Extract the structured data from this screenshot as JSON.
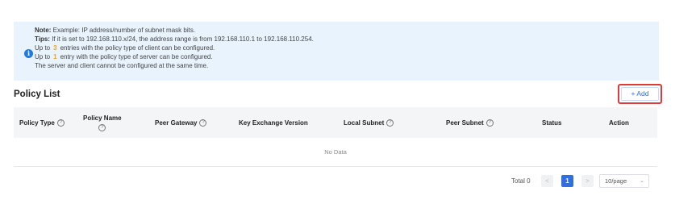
{
  "notice": {
    "lines": [
      {
        "label": "Note:",
        "text": " Example: IP address/number of subnet mask bits."
      },
      {
        "label": "Tips:",
        "text": " If it is set to 192.168.110.x/24, the address range is from 192.168.110.1 to 192.168.110.254."
      }
    ],
    "client_limit": {
      "prefix": "Up to",
      "count": "3",
      "suffix": "entries with the policy type of client can be configured."
    },
    "server_limit": {
      "prefix": "Up to",
      "count": "1",
      "suffix": "entry with the policy type of server can be configured."
    },
    "exclusive_note": "The server and client cannot be configured at the same time."
  },
  "policy_list": {
    "title": "Policy List",
    "add_label": "+ Add"
  },
  "table": {
    "columns": [
      {
        "label": "Policy Type",
        "help": true
      },
      {
        "label": "Policy Name",
        "help": true
      },
      {
        "label": "Peer Gateway",
        "help": true
      },
      {
        "label": "Key Exchange Version",
        "help": false
      },
      {
        "label": "Local Subnet",
        "help": true
      },
      {
        "label": "Peer Subnet",
        "help": true
      },
      {
        "label": "Status",
        "help": false
      },
      {
        "label": "Action",
        "help": false
      }
    ],
    "help_glyph": "?",
    "empty_text": "No Data"
  },
  "pagination": {
    "total_text": "Total 0",
    "prev": "<",
    "current_page": "1",
    "next": ">",
    "page_size": "10/page",
    "chevron": "⌄"
  },
  "colors": {
    "accent": "#2f6fe0",
    "highlight_border": "#e03b3b",
    "notice_bg": "#e8f3fd",
    "count_color": "#f0a020"
  },
  "icons": {
    "notice": "info-icon",
    "column_help": "question-circle-icon",
    "page_size": "chevron-down-icon"
  }
}
